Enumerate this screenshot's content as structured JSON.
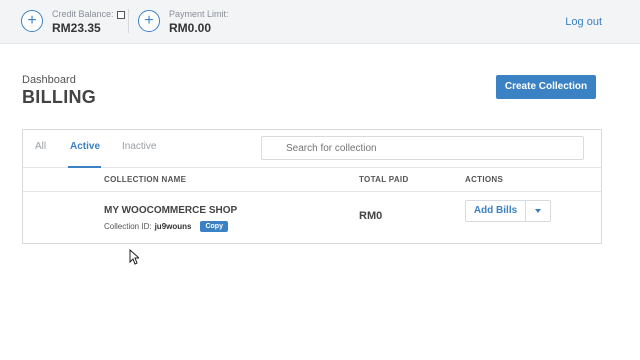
{
  "topbar": {
    "credit_label": "Credit Balance:",
    "credit_value": "RM23.35",
    "payment_label": "Payment Limit:",
    "payment_value": "RM0.00",
    "logout_label": "Log out",
    "add_glyph": "+"
  },
  "header": {
    "breadcrumb": "Dashboard",
    "title": "BILLING",
    "create_label": "Create Collection"
  },
  "tabs": {
    "all": "All",
    "active": "Active",
    "inactive": "Inactive"
  },
  "search": {
    "placeholder": "Search for collection"
  },
  "table": {
    "headers": {
      "name": "COLLECTION NAME",
      "paid": "TOTAL PAID",
      "actions": "ACTIONS"
    },
    "rows": [
      {
        "name": "MY WOOCOMMERCE SHOP",
        "id_label": "Collection ID:",
        "id_value": "ju9wouns",
        "copy_label": "Copy",
        "total_paid": "RM0",
        "action_label": "Add Bills"
      }
    ]
  },
  "colors": {
    "accent": "#3b82c4"
  },
  "icons": {
    "add": "plus-circle-icon",
    "dropdown": "caret-down-icon",
    "cursor": "mouse-pointer-icon"
  }
}
